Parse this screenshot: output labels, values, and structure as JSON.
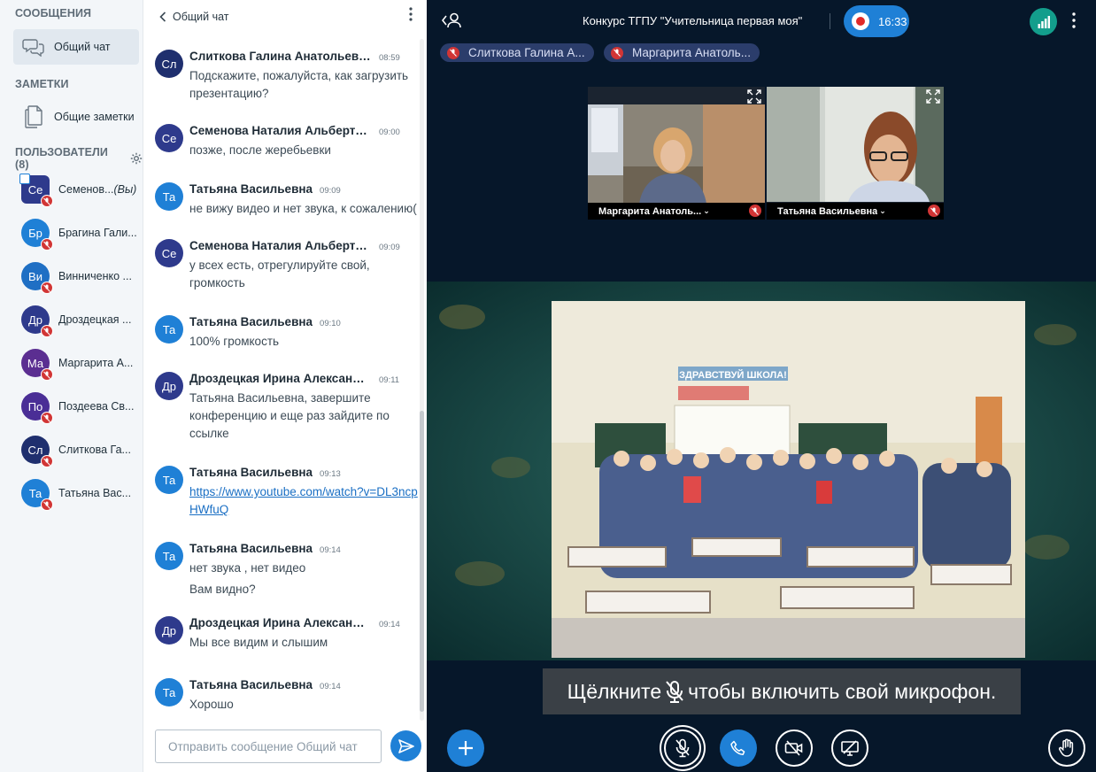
{
  "sidebar": {
    "messages_title": "СООБЩЕНИЯ",
    "public_chat_label": "Общий чат",
    "notes_title": "ЗАМЕТКИ",
    "shared_notes_label": "Общие заметки",
    "users_title": "ПОЛЬЗОВАТЕЛИ (8)",
    "users": [
      {
        "initials": "Се",
        "name": "Семенов...",
        "you": "(Вы)",
        "color": "#2e3a8c"
      },
      {
        "initials": "Бр",
        "name": "Брагина Гали...",
        "color": "#1f80d6"
      },
      {
        "initials": "Ви",
        "name": "Винниченко ...",
        "color": "#1f6fc4"
      },
      {
        "initials": "Др",
        "name": "Дроздецкая ...",
        "color": "#2e3a8c"
      },
      {
        "initials": "Ма",
        "name": "Маргарита А...",
        "color": "#5b2e91"
      },
      {
        "initials": "По",
        "name": "Поздеева Св...",
        "color": "#4a2e96"
      },
      {
        "initials": "Сл",
        "name": "Слиткова Га...",
        "color": "#1f2f6e"
      },
      {
        "initials": "Та",
        "name": "Татьяна Вас...",
        "color": "#1f80d6"
      }
    ]
  },
  "chat": {
    "title": "Общий чат",
    "input_placeholder": "Отправить сообщение Общий чат",
    "messages": [
      {
        "initials": "Сл",
        "color": "#1f2f6e",
        "name": "Слиткова Галина Анатольевна",
        "time": "08:59",
        "text": "Подскажите, пожалуйста, как загрузить презентацию?"
      },
      {
        "initials": "Се",
        "color": "#2e3a8c",
        "name": "Семенова Наталия Альбертовна",
        "time": "09:00",
        "text": "позже, после жеребьевки"
      },
      {
        "initials": "Та",
        "color": "#1f80d6",
        "name": "Татьяна Васильевна",
        "time": "09:09",
        "text": "не вижу видео и нет звука, к сожалению("
      },
      {
        "initials": "Се",
        "color": "#2e3a8c",
        "name": "Семенова Наталия Альбертовна",
        "time": "09:09",
        "text": "у всех есть, отрегулируйте свой, громкость"
      },
      {
        "initials": "Та",
        "color": "#1f80d6",
        "name": "Татьяна Васильевна",
        "time": "09:10",
        "text": "100% громкость"
      },
      {
        "initials": "Др",
        "color": "#2e3a8c",
        "name": "Дроздецкая Ирина Александровна",
        "time": "09:11",
        "text": "Татьяна Васильевна, завершите конференцию и еще раз зайдите по ссылке"
      },
      {
        "initials": "Та",
        "color": "#1f80d6",
        "name": "Татьяна Васильевна",
        "time": "09:13",
        "link": "https://www.youtube.com/watch?v=DL3ncpHWfuQ"
      },
      {
        "initials": "Та",
        "color": "#1f80d6",
        "name": "Татьяна Васильевна",
        "time": "09:14",
        "text": "нет звука , нет видео",
        "text2": "Вам видно?"
      },
      {
        "initials": "Др",
        "color": "#2e3a8c",
        "name": "Дроздецкая Ирина Александровна",
        "time": "09:14",
        "text": "Мы все видим и слышим"
      },
      {
        "initials": "Та",
        "color": "#1f80d6",
        "name": "Татьяна Васильевна",
        "time": "09:14",
        "text": "Хорошо"
      }
    ]
  },
  "meeting": {
    "title": "Конкурс ТГПУ \"Учительница первая моя\"",
    "record_time": "16:33",
    "talkers": [
      "Слиткова Галина А...",
      "Маргарита Анатоль..."
    ],
    "cameras": [
      {
        "name": "Маргарита Анатоль..."
      },
      {
        "name": "Татьяна Васильевна"
      }
    ],
    "screen_banner": "ЗДРАВСТВУЙ ШКОЛА!",
    "hint_before": "Щёлкните",
    "hint_after": "чтобы включить свой микрофон."
  },
  "colors": {
    "accent": "#1f80d6",
    "muted_red": "#d13535",
    "dark_bg": "#06172a",
    "connection_green": "#139e8c"
  }
}
